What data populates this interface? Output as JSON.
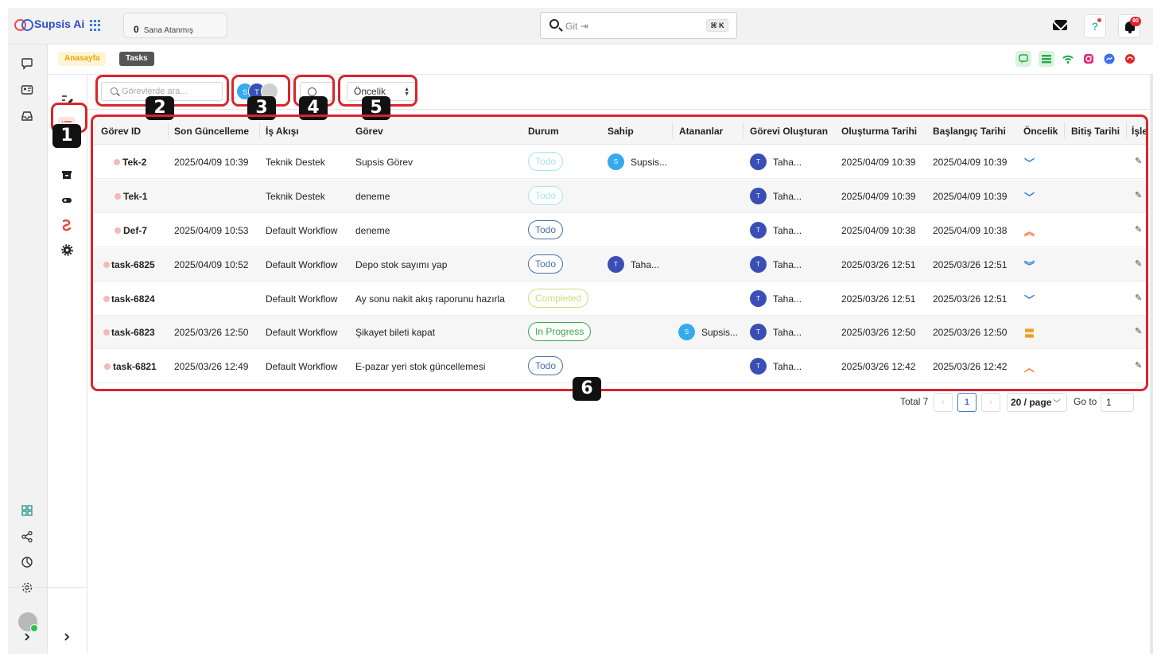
{
  "app": {
    "name": "Supsis Ai"
  },
  "header": {
    "assigned_count": "0",
    "assigned_label": "Sana Atanmış",
    "search_placeholder": "Git ⇥",
    "search_shortcut": "⌘ K",
    "help_glyph": "?",
    "notification_count": "90"
  },
  "breadcrumb": {
    "home": "Anasayfa",
    "current": "Tasks"
  },
  "toolbar": {
    "search_placeholder": "Görevlerde ara...",
    "assignee_avatars": [
      "S",
      "T"
    ],
    "priority_select": "Öncelik"
  },
  "callouts": [
    "1",
    "2",
    "3",
    "4",
    "5",
    "6"
  ],
  "table": {
    "columns": [
      "Görev ID",
      "Son Güncelleme",
      "İş Akışı",
      "Görev",
      "Durum",
      "Sahip",
      "Atananlar",
      "Görevi Oluşturan",
      "Oluşturma Tarihi",
      "Başlangıç Tarihi",
      "Öncelik",
      "Bitiş Tarihi",
      "İşle"
    ],
    "rows": [
      {
        "id": "Tek-2",
        "updated": "2025/04/09 10:39",
        "workflow": "Teknik Destek",
        "task": "Supsis Görev",
        "status": "Todo",
        "owner_initial": "S",
        "owner": "Supsis...",
        "assignee_initial": "",
        "assignee": "",
        "creator_initial": "T",
        "creator": "Taha...",
        "created": "2025/04/09 10:39",
        "start": "2025/04/09 10:39",
        "priority_glyph": "﹀",
        "end": ""
      },
      {
        "id": "Tek-1",
        "updated": "",
        "workflow": "Teknik Destek",
        "task": "deneme",
        "status": "Todo",
        "owner_initial": "",
        "owner": "",
        "assignee_initial": "",
        "assignee": "",
        "creator_initial": "T",
        "creator": "Taha...",
        "created": "2025/04/09 10:39",
        "start": "2025/04/09 10:39",
        "priority_glyph": "﹀",
        "end": ""
      },
      {
        "id": "Def-7",
        "updated": "2025/04/09 10:53",
        "workflow": "Default Workflow",
        "task": "deneme",
        "status": "Todo",
        "owner_initial": "",
        "owner": "",
        "assignee_initial": "",
        "assignee": "",
        "creator_initial": "T",
        "creator": "Taha...",
        "created": "2025/04/09 10:38",
        "start": "2025/04/09 10:38",
        "priority_glyph": "︽",
        "end": ""
      },
      {
        "id": "task-6825",
        "updated": "2025/04/09 10:52",
        "workflow": "Default Workflow",
        "task": "Depo stok sayımı yap",
        "status": "Todo",
        "owner_initial": "T",
        "owner": "Taha...",
        "assignee_initial": "",
        "assignee": "",
        "creator_initial": "T",
        "creator": "Taha...",
        "created": "2025/03/26 12:51",
        "start": "2025/03/26 12:51",
        "priority_glyph": "︾",
        "end": ""
      },
      {
        "id": "task-6824",
        "updated": "",
        "workflow": "Default Workflow",
        "task": "Ay sonu nakit akış raporunu hazırla",
        "status": "Completed",
        "owner_initial": "",
        "owner": "",
        "assignee_initial": "",
        "assignee": "",
        "creator_initial": "T",
        "creator": "Taha...",
        "created": "2025/03/26 12:51",
        "start": "2025/03/26 12:51",
        "priority_glyph": "﹀",
        "end": ""
      },
      {
        "id": "task-6823",
        "updated": "2025/03/26 12:50",
        "workflow": "Default Workflow",
        "task": "Şikayet bileti kapat",
        "status": "In Progress",
        "owner_initial": "",
        "owner": "",
        "assignee_initial": "S",
        "assignee": "Supsis...",
        "creator_initial": "T",
        "creator": "Taha...",
        "created": "2025/03/26 12:50",
        "start": "2025/03/26 12:50",
        "priority_glyph": "〓",
        "end": ""
      },
      {
        "id": "task-6821",
        "updated": "2025/03/26 12:49",
        "workflow": "Default Workflow",
        "task": "E-pazar yeri stok güncellemesi",
        "status": "Todo",
        "owner_initial": "",
        "owner": "",
        "assignee_initial": "",
        "assignee": "",
        "creator_initial": "T",
        "creator": "Taha...",
        "created": "2025/03/26 12:42",
        "start": "2025/03/26 12:42",
        "priority_glyph": "︿",
        "end": ""
      }
    ]
  },
  "pagination": {
    "total": "Total 7",
    "prev": "‹",
    "page": "1",
    "next": "›",
    "page_size": "20 / page",
    "goto_label": "Go to",
    "goto_value": "1"
  },
  "colors": {
    "brand_blue": "#2f49c8",
    "highlight_red": "#d9252c",
    "todo_blue": "#4a6fa5",
    "todo_faint": "#a8e4ef",
    "completed": "#c8e07a",
    "in_progress": "#3aa84a",
    "prio_low": "#2f7be0",
    "prio_high": "#f07a3a",
    "prio_medium": "#f0a020",
    "avatar_s": "#36a9f0",
    "avatar_t": "#3a4fb5"
  }
}
